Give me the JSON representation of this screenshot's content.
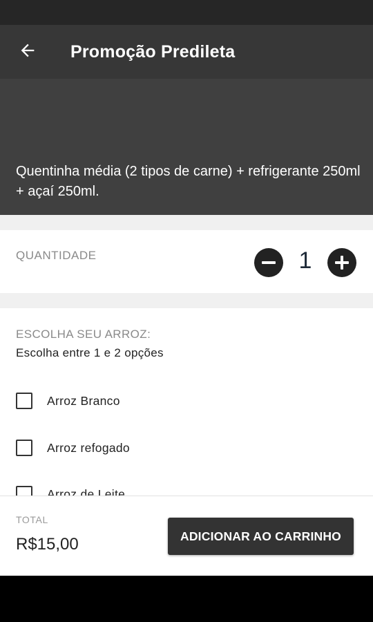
{
  "app_bar": {
    "back_icon": "arrow-left-icon",
    "title": "Promoção Predileta"
  },
  "product": {
    "description": "Quentinha média (2 tipos de carne) + refrigerante 250ml + açaí 250ml."
  },
  "quantity": {
    "label": "QUANTIDADE",
    "value": "1",
    "decrement_icon": "minus-circle-icon",
    "increment_icon": "plus-circle-icon"
  },
  "rice_section": {
    "title": "ESCOLHA SEU ARROZ:",
    "subtitle": "Escolha entre 1 e 2 opções",
    "options": [
      {
        "label": "Arroz Branco",
        "checked": false
      },
      {
        "label": "Arroz refogado",
        "checked": false
      },
      {
        "label": "Arroz de Leite",
        "checked": false
      }
    ]
  },
  "footer": {
    "total_label": "TOTAL",
    "total_value": "R$15,00",
    "add_button": "ADICIONAR AO CARRINHO"
  },
  "colors": {
    "app_bar": "#373737",
    "hero": "#404040",
    "button": "#333333",
    "quantity_value": "#1e2a38"
  }
}
